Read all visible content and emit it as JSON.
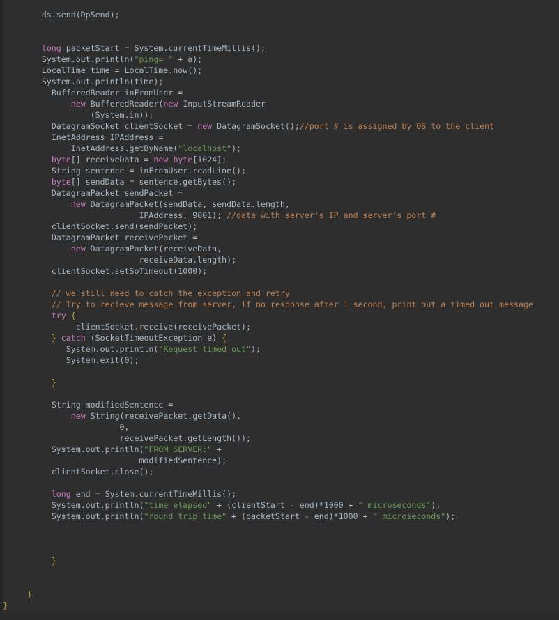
{
  "editor": {
    "language": "java",
    "background": "#2e2e2e",
    "gutter_color": "#252525",
    "default_text_color": "#a9b7c6",
    "keyword_color": "#c679bd",
    "string_color": "#6a9b55",
    "comment_color": "#c08050",
    "brace_color": "#b5a642",
    "font_size_px": 11.6,
    "line_height_px": 16
  },
  "code": {
    "lines": [
      {
        "indent": 8,
        "tokens": [
          {
            "t": "id",
            "v": "ds.send(DpSend);"
          }
        ]
      },
      {
        "indent": 0,
        "tokens": []
      },
      {
        "indent": 0,
        "tokens": []
      },
      {
        "indent": 8,
        "tokens": [
          {
            "t": "key",
            "v": "long"
          },
          {
            "t": "id",
            "v": " packetStart = System.currentTimeMillis();"
          }
        ]
      },
      {
        "indent": 8,
        "tokens": [
          {
            "t": "id",
            "v": "System.out.println("
          },
          {
            "t": "str",
            "v": "\"ping= \""
          },
          {
            "t": "id",
            "v": " + a);"
          }
        ]
      },
      {
        "indent": 8,
        "tokens": [
          {
            "t": "id",
            "v": "LocalTime time = LocalTime.now();"
          }
        ]
      },
      {
        "indent": 8,
        "tokens": [
          {
            "t": "id",
            "v": "System.out.println(time);"
          }
        ]
      },
      {
        "indent": 10,
        "tokens": [
          {
            "t": "id",
            "v": "BufferedReader inFromUser ="
          }
        ]
      },
      {
        "indent": 14,
        "tokens": [
          {
            "t": "key",
            "v": "new"
          },
          {
            "t": "id",
            "v": " BufferedReader("
          },
          {
            "t": "key",
            "v": "new"
          },
          {
            "t": "id",
            "v": " InputStreamReader"
          }
        ]
      },
      {
        "indent": 18,
        "tokens": [
          {
            "t": "id",
            "v": "(System.in));"
          }
        ]
      },
      {
        "indent": 10,
        "tokens": [
          {
            "t": "id",
            "v": "DatagramSocket clientSocket = "
          },
          {
            "t": "key",
            "v": "new"
          },
          {
            "t": "id",
            "v": " DatagramSocket();"
          },
          {
            "t": "cmt",
            "v": "//port # is assigned by OS to the client"
          }
        ]
      },
      {
        "indent": 10,
        "tokens": [
          {
            "t": "id",
            "v": "InetAddress IPAddress ="
          }
        ]
      },
      {
        "indent": 14,
        "tokens": [
          {
            "t": "id",
            "v": "InetAddress.getByName("
          },
          {
            "t": "str",
            "v": "\"localhost\""
          },
          {
            "t": "id",
            "v": ");"
          }
        ]
      },
      {
        "indent": 10,
        "tokens": [
          {
            "t": "key",
            "v": "byte"
          },
          {
            "t": "id",
            "v": "[] receiveData = "
          },
          {
            "t": "key",
            "v": "new"
          },
          {
            "t": "id",
            "v": " "
          },
          {
            "t": "key",
            "v": "byte"
          },
          {
            "t": "id",
            "v": "[1024];"
          }
        ]
      },
      {
        "indent": 10,
        "tokens": [
          {
            "t": "id",
            "v": "String sentence = inFromUser.readLine();"
          }
        ]
      },
      {
        "indent": 10,
        "tokens": [
          {
            "t": "key",
            "v": "byte"
          },
          {
            "t": "id",
            "v": "[] sendData = sentence.getBytes();"
          }
        ]
      },
      {
        "indent": 10,
        "tokens": [
          {
            "t": "id",
            "v": "DatagramPacket sendPacket ="
          }
        ]
      },
      {
        "indent": 14,
        "tokens": [
          {
            "t": "key",
            "v": "new"
          },
          {
            "t": "id",
            "v": " DatagramPacket(sendData, sendData.length,"
          }
        ]
      },
      {
        "indent": 28,
        "tokens": [
          {
            "t": "id",
            "v": "IPAddress, 9001); "
          },
          {
            "t": "cmt",
            "v": "//data with server's IP and server's port #"
          }
        ]
      },
      {
        "indent": 10,
        "tokens": [
          {
            "t": "id",
            "v": "clientSocket.send(sendPacket);"
          }
        ]
      },
      {
        "indent": 10,
        "tokens": [
          {
            "t": "id",
            "v": "DatagramPacket receivePacket ="
          }
        ]
      },
      {
        "indent": 14,
        "tokens": [
          {
            "t": "key",
            "v": "new"
          },
          {
            "t": "id",
            "v": " DatagramPacket(receiveData,"
          }
        ]
      },
      {
        "indent": 28,
        "tokens": [
          {
            "t": "id",
            "v": "receiveData.length);"
          }
        ]
      },
      {
        "indent": 10,
        "tokens": [
          {
            "t": "id",
            "v": "clientSocket.setSoTimeout(1000);"
          }
        ]
      },
      {
        "indent": 0,
        "tokens": []
      },
      {
        "indent": 10,
        "tokens": [
          {
            "t": "cmt",
            "v": "// we still need to catch the exception and retry"
          }
        ]
      },
      {
        "indent": 10,
        "tokens": [
          {
            "t": "cmt",
            "v": "// Try to recieve message from server, if no response after 1 second, print out a timed out message"
          }
        ]
      },
      {
        "indent": 10,
        "tokens": [
          {
            "t": "key",
            "v": "try"
          },
          {
            "t": "id",
            "v": " "
          },
          {
            "t": "brace",
            "v": "{"
          }
        ]
      },
      {
        "indent": 15,
        "tokens": [
          {
            "t": "id",
            "v": "clientSocket.receive(receivePacket);"
          }
        ]
      },
      {
        "indent": 10,
        "tokens": [
          {
            "t": "brace",
            "v": "}"
          },
          {
            "t": "id",
            "v": " "
          },
          {
            "t": "key",
            "v": "catch"
          },
          {
            "t": "id",
            "v": " (SocketTimeoutException e) "
          },
          {
            "t": "brace",
            "v": "{"
          }
        ]
      },
      {
        "indent": 13,
        "tokens": [
          {
            "t": "id",
            "v": "System.out.println("
          },
          {
            "t": "str",
            "v": "\"Request timed out\""
          },
          {
            "t": "id",
            "v": ");"
          }
        ]
      },
      {
        "indent": 13,
        "tokens": [
          {
            "t": "id",
            "v": "System.exit(0);"
          }
        ]
      },
      {
        "indent": 0,
        "tokens": []
      },
      {
        "indent": 10,
        "tokens": [
          {
            "t": "brace",
            "v": "}"
          }
        ]
      },
      {
        "indent": 0,
        "tokens": []
      },
      {
        "indent": 10,
        "tokens": [
          {
            "t": "id",
            "v": "String modifiedSentence ="
          }
        ]
      },
      {
        "indent": 14,
        "tokens": [
          {
            "t": "key",
            "v": "new"
          },
          {
            "t": "id",
            "v": " String(receivePacket.getData(),"
          }
        ]
      },
      {
        "indent": 24,
        "tokens": [
          {
            "t": "id",
            "v": "0,"
          }
        ]
      },
      {
        "indent": 24,
        "tokens": [
          {
            "t": "id",
            "v": "receivePacket.getLength());"
          }
        ]
      },
      {
        "indent": 10,
        "tokens": [
          {
            "t": "id",
            "v": "System.out.println("
          },
          {
            "t": "str",
            "v": "\"FROM SERVER:\""
          },
          {
            "t": "id",
            "v": " +"
          }
        ]
      },
      {
        "indent": 28,
        "tokens": [
          {
            "t": "id",
            "v": "modifiedSentence);"
          }
        ]
      },
      {
        "indent": 10,
        "tokens": [
          {
            "t": "id",
            "v": "clientSocket.close();"
          }
        ]
      },
      {
        "indent": 0,
        "tokens": []
      },
      {
        "indent": 10,
        "tokens": [
          {
            "t": "key",
            "v": "long"
          },
          {
            "t": "id",
            "v": " end = System.currentTimeMillis();"
          }
        ]
      },
      {
        "indent": 10,
        "tokens": [
          {
            "t": "id",
            "v": "System.out.println("
          },
          {
            "t": "str",
            "v": "\"time elapsed\""
          },
          {
            "t": "id",
            "v": " + (clientStart - end)*1000 + "
          },
          {
            "t": "str",
            "v": "\" microseconds\""
          },
          {
            "t": "id",
            "v": ");"
          }
        ]
      },
      {
        "indent": 10,
        "tokens": [
          {
            "t": "id",
            "v": "System.out.println("
          },
          {
            "t": "str",
            "v": "\"round trip time\""
          },
          {
            "t": "id",
            "v": " + (packetStart - end)*1000 + "
          },
          {
            "t": "str",
            "v": "\" microseconds\""
          },
          {
            "t": "id",
            "v": ");"
          }
        ]
      },
      {
        "indent": 0,
        "tokens": []
      },
      {
        "indent": 0,
        "tokens": []
      },
      {
        "indent": 0,
        "tokens": []
      },
      {
        "indent": 10,
        "tokens": [
          {
            "t": "brace",
            "v": "}"
          }
        ]
      },
      {
        "indent": 0,
        "tokens": []
      },
      {
        "indent": 0,
        "tokens": []
      },
      {
        "indent": 5,
        "tokens": [
          {
            "t": "brace",
            "v": "}"
          }
        ]
      },
      {
        "indent": 0,
        "tokens": [
          {
            "t": "brace",
            "v": "}"
          }
        ]
      }
    ]
  }
}
